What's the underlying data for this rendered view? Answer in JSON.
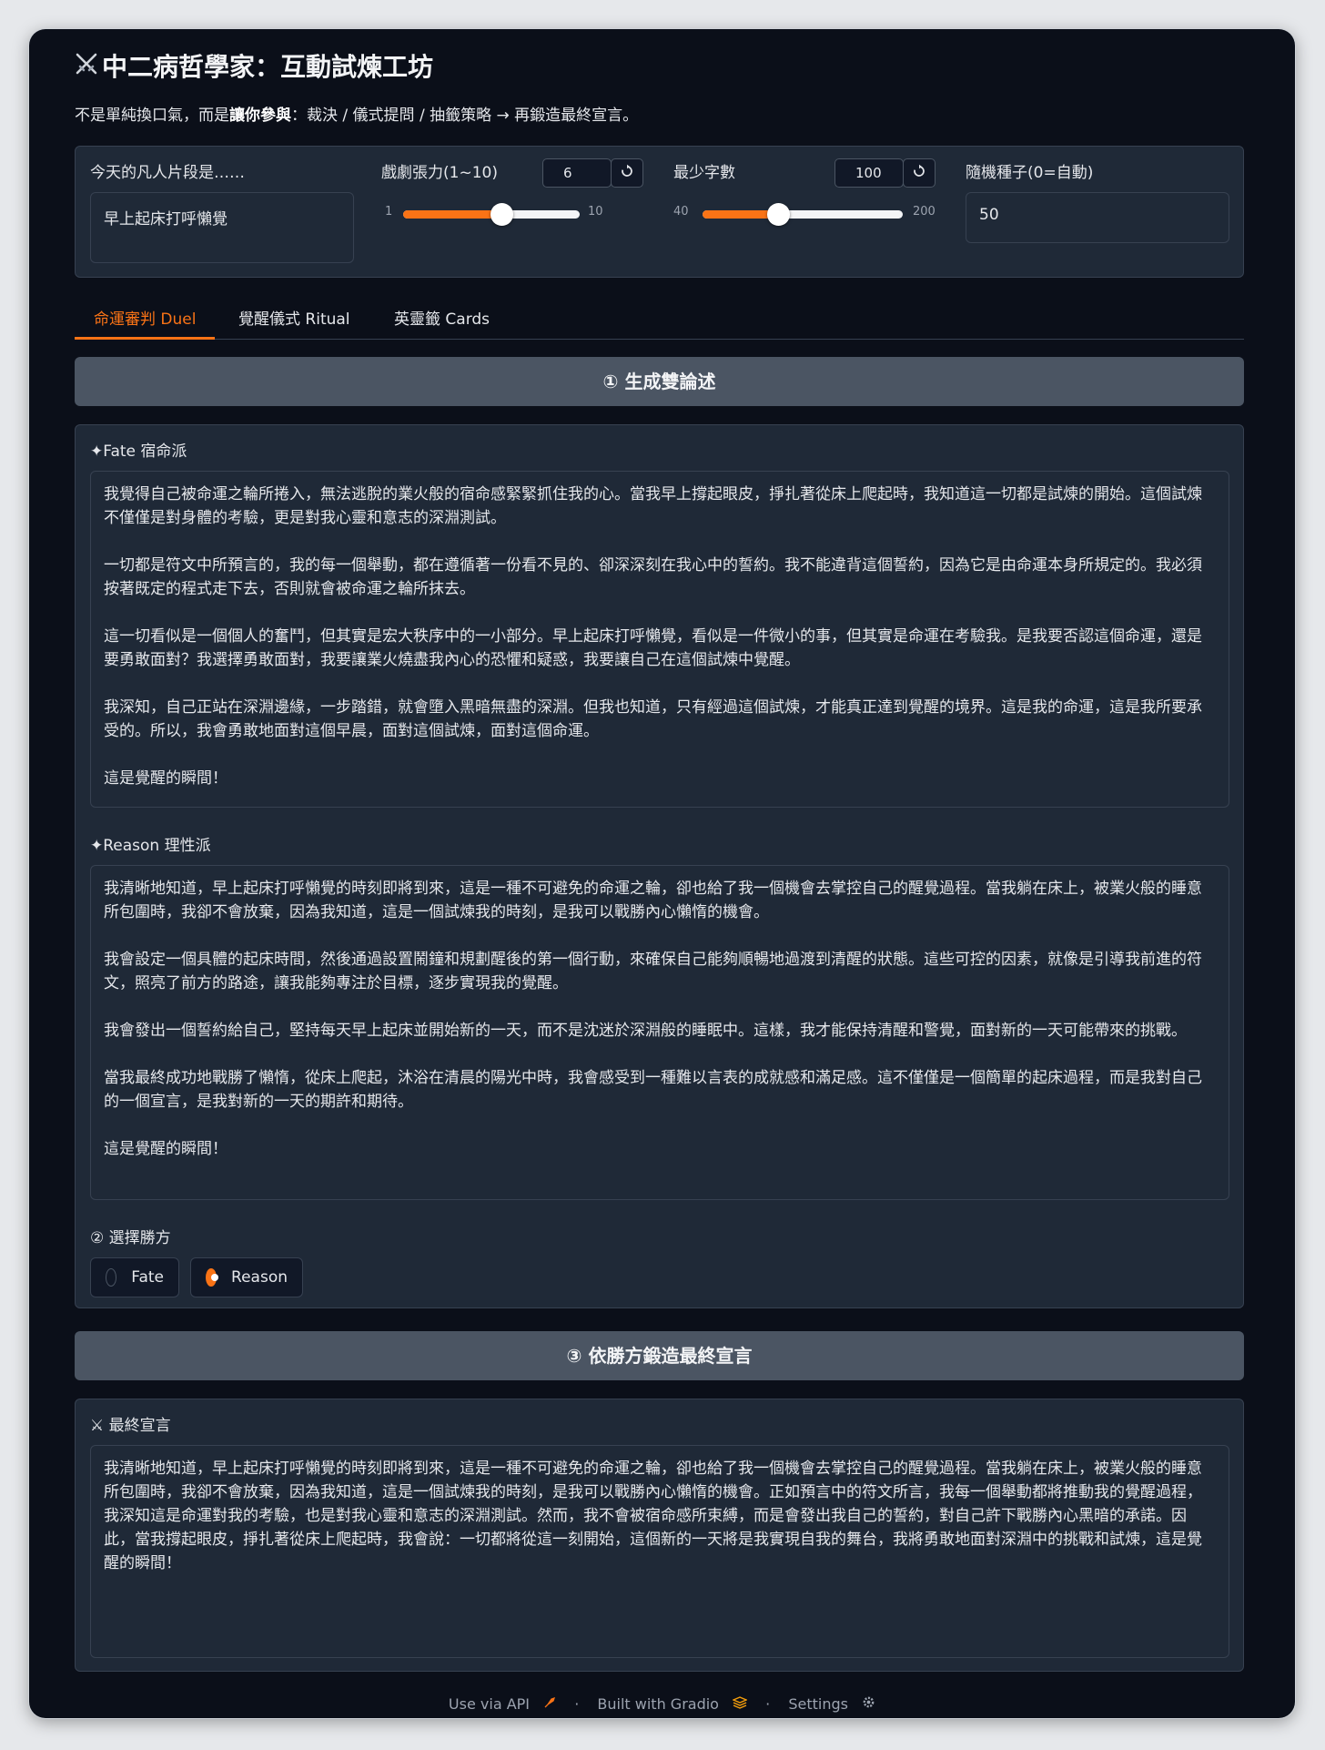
{
  "header": {
    "title": "中二病哲學家：互動試煉工坊",
    "subtitle_pre": "不是單純換口氣，而是",
    "subtitle_bold": "讓你參與",
    "subtitle_post": "：裁決 / 儀式提問 / 抽籤策略 → 再鍛造最終宣言。"
  },
  "controls": {
    "segment": {
      "label": "今天的凡人片段是……",
      "value": "早上起床打呼懶覺"
    },
    "drama": {
      "label": "戲劇張力(1~10)",
      "value": 6,
      "min": 1,
      "max": 10,
      "min_label": "1",
      "max_label": "10",
      "value_label": "6"
    },
    "min_words": {
      "label": "最少字數",
      "value": 100,
      "min": 40,
      "max": 200,
      "min_label": "40",
      "max_label": "200",
      "value_label": "100"
    },
    "seed": {
      "label": "隨機種子(0=自動)",
      "value": "50"
    }
  },
  "tabs": [
    {
      "label": "命運審判 Duel",
      "active": true
    },
    {
      "label": "覺醒儀式 Ritual",
      "active": false
    },
    {
      "label": "英靈籤 Cards",
      "active": false
    }
  ],
  "duel": {
    "generate_button": "① 生成雙論述",
    "fate_label": "✦Fate 宿命派",
    "fate_paragraphs": [
      "我覺得自己被命運之輪所捲入，無法逃脫的業火般的宿命感緊緊抓住我的心。當我早上撐起眼皮，掙扎著從床上爬起時，我知道這一切都是試煉的開始。這個試煉不僅僅是對身體的考驗，更是對我心靈和意志的深淵測試。",
      "一切都是符文中所預言的，我的每一個舉動，都在遵循著一份看不見的、卻深深刻在我心中的誓約。我不能違背這個誓約，因為它是由命運本身所規定的。我必須按著既定的程式走下去，否則就會被命運之輪所抹去。",
      "這一切看似是一個個人的奮鬥，但其實是宏大秩序中的一小部分。早上起床打呼懶覺，看似是一件微小的事，但其實是命運在考驗我。是我要否認這個命運，還是要勇敢面對？我選擇勇敢面對，我要讓業火燒盡我內心的恐懼和疑惑，我要讓自己在這個試煉中覺醒。",
      "我深知，自己正站在深淵邊緣，一步踏錯，就會墮入黑暗無盡的深淵。但我也知道，只有經過這個試煉，才能真正達到覺醒的境界。這是我的命運，這是我所要承受的。所以，我會勇敢地面對這個早晨，面對這個試煉，面對這個命運。",
      "這是覺醒的瞬間！"
    ],
    "reason_label": "✦Reason 理性派",
    "reason_paragraphs": [
      "我清晰地知道，早上起床打呼懶覺的時刻即將到來，這是一種不可避免的命運之輪，卻也給了我一個機會去掌控自己的醒覺過程。當我躺在床上，被業火般的睡意所包圍時，我卻不會放棄，因為我知道，這是一個試煉我的時刻，是我可以戰勝內心懶惰的機會。",
      "我會設定一個具體的起床時間，然後通過設置鬧鐘和規劃醒後的第一個行動，來確保自己能夠順暢地過渡到清醒的狀態。這些可控的因素，就像是引導我前進的符文，照亮了前方的路途，讓我能夠專注於目標，逐步實現我的覺醒。",
      "我會發出一個誓約給自己，堅持每天早上起床並開始新的一天，而不是沈迷於深淵般的睡眠中。這樣，我才能保持清醒和警覺，面對新的一天可能帶來的挑戰。",
      "當我最終成功地戰勝了懶惰，從床上爬起，沐浴在清晨的陽光中時，我會感受到一種難以言表的成就感和滿足感。這不僅僅是一個簡單的起床過程，而是我對自己的一個宣言，是我對新的一天的期許和期待。",
      "這是覺醒的瞬間！"
    ],
    "winner_label": "② 選擇勝方",
    "options": [
      {
        "label": "Fate",
        "selected": false
      },
      {
        "label": "Reason",
        "selected": true
      }
    ],
    "forge_button": "③ 依勝方鍛造最終宣言",
    "final_label": "⚔ 最終宣言",
    "final_text": "我清晰地知道，早上起床打呼懶覺的時刻即將到來，這是一種不可避免的命運之輪，卻也給了我一個機會去掌控自己的醒覺過程。當我躺在床上，被業火般的睡意所包圍時，我卻不會放棄，因為我知道，這是一個試煉我的時刻，是我可以戰勝內心懶惰的機會。正如預言中的符文所言，我每一個舉動都將推動我的覺醒過程，我深知這是命運對我的考驗，也是對我心靈和意志的深淵測試。然而，我不會被宿命感所束縛，而是會發出我自己的誓約，對自己許下戰勝內心黑暗的承諾。因此，當我撐起眼皮，掙扎著從床上爬起時，我會說：一切都將從這一刻開始，這個新的一天將是我實現自我的舞台，我將勇敢地面對深淵中的挑戰和試煉，這是覺醒的瞬間！"
  },
  "footer": {
    "api": "Use via API",
    "built": "Built with Gradio",
    "settings": "Settings",
    "sep": "·"
  },
  "colors": {
    "accent": "#f97316",
    "background": "#0b0f19",
    "panel": "#1f2937",
    "button": "#4b5563"
  }
}
